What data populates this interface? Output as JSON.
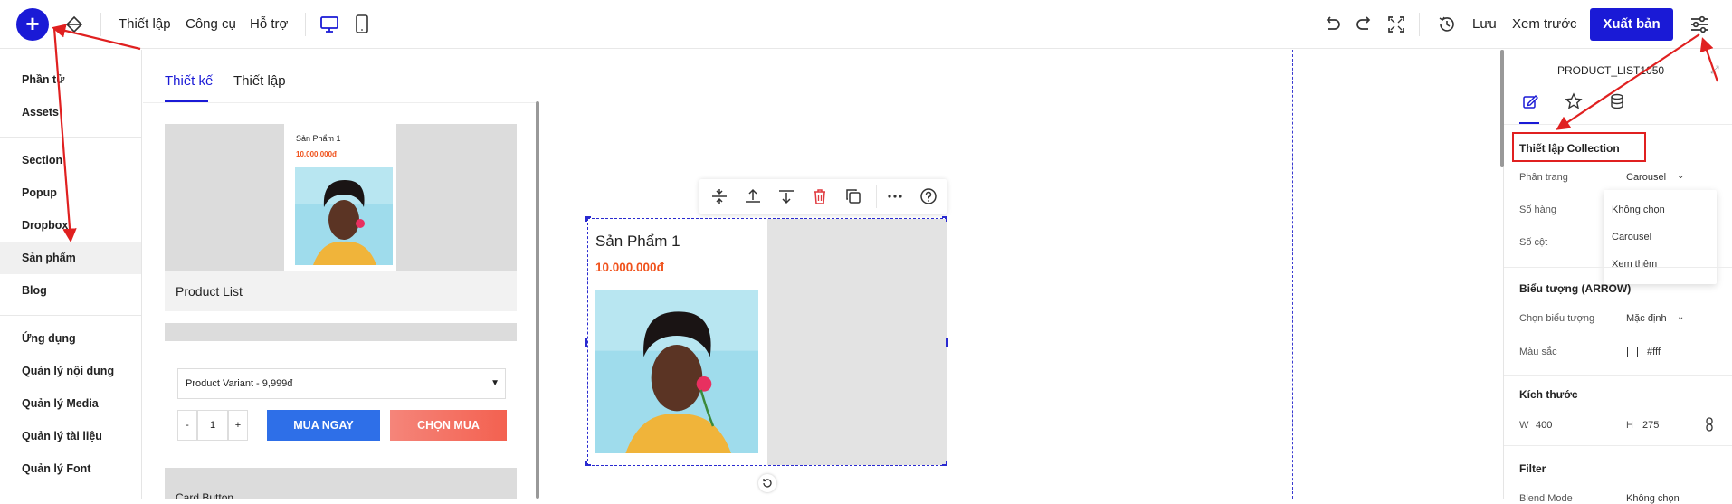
{
  "colors": {
    "accent": "#1a1ad6",
    "price": "#f0521c",
    "buy_now": "#2e6fe8",
    "add_to_cart": "#f36f5e",
    "annotation": "#e02020"
  },
  "topbar": {
    "menu": [
      "Thiết lập",
      "Công cụ",
      "Hỗ trợ"
    ],
    "save": "Lưu",
    "preview": "Xem trước",
    "publish": "Xuất bản"
  },
  "sidebar": {
    "items": [
      "Phần tử",
      "Assets",
      "Section",
      "Popup",
      "Dropbox",
      "Sản phẩm",
      "Blog",
      "Ứng dụng",
      "Quản lý nội dung",
      "Quản lý Media",
      "Quản lý tài liệu",
      "Quản lý Font"
    ],
    "active": "Sản phẩm"
  },
  "panel": {
    "tabs": [
      "Thiết kế",
      "Thiết lập"
    ],
    "card": {
      "product_title": "Sản Phẩm 1",
      "product_price": "10.000.000đ",
      "label": "Product List"
    },
    "variant_select": "Product Variant - 9,999đ",
    "quantity": {
      "minus": "-",
      "value": "1",
      "plus": "+"
    },
    "buy_now": "MUA NGAY",
    "add_to_cart": "CHỌN MUA",
    "next_card_label": "Card Button"
  },
  "canvas": {
    "product_title": "Sản Phẩm 1",
    "product_price": "10.000.000đ"
  },
  "inspector": {
    "title": "PRODUCT_LIST1050",
    "collection_section": "Thiết lập Collection",
    "pagination_label": "Phân trang",
    "pagination_value": "Carousel",
    "rows_label": "Số hàng",
    "cols_label": "Số cột",
    "dropdown_options": [
      "Không chọn",
      "Carousel",
      "Xem thêm"
    ],
    "arrow_section": "Biểu tượng (ARROW)",
    "choose_icon_label": "Chọn biểu tượng",
    "choose_icon_value": "Mặc định",
    "color_label": "Màu sắc",
    "color_value": "#fff",
    "size_section": "Kích thước",
    "w_label": "W",
    "w_value": "400",
    "h_label": "H",
    "h_value": "275",
    "filter_section": "Filter",
    "blend_label": "Blend Mode",
    "blend_value": "Không chọn"
  }
}
